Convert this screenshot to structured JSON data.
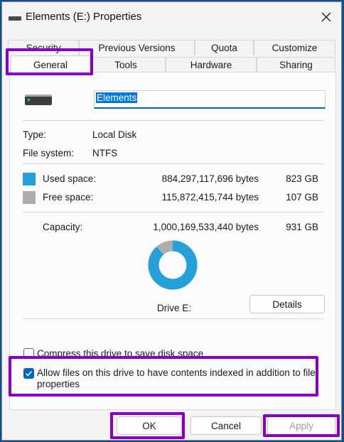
{
  "window": {
    "title": "Elements (E:) Properties"
  },
  "tabs": {
    "row1": [
      "Security",
      "Previous Versions",
      "Quota",
      "Customize"
    ],
    "row2": [
      "General",
      "Tools",
      "Hardware",
      "Sharing"
    ],
    "active": "General"
  },
  "general": {
    "drive_name": "Elements",
    "type_label": "Type:",
    "type_value": "Local Disk",
    "fs_label": "File system:",
    "fs_value": "NTFS",
    "used_label": "Used space:",
    "used_bytes": "884,297,117,696 bytes",
    "used_gb": "823 GB",
    "free_label": "Free space:",
    "free_bytes": "115,872,415,744 bytes",
    "free_gb": "107 GB",
    "capacity_label": "Capacity:",
    "capacity_bytes": "1,000,169,533,440 bytes",
    "capacity_gb": "931 GB",
    "drive_caption": "Drive E:",
    "details_label": "Details",
    "used_fraction": 0.884,
    "compress_label": "Compress this drive to save disk space",
    "compress_checked": false,
    "index_label_line1": "Allow files on this drive to have contents indexed in addition to file",
    "index_label_line2": "properties",
    "index_checked": true
  },
  "colors": {
    "used": "#26a0da",
    "free": "#adadad",
    "highlight": "#8a00c2",
    "accent": "#0067c0"
  },
  "buttons": {
    "ok": "OK",
    "cancel": "Cancel",
    "apply": "Apply"
  }
}
